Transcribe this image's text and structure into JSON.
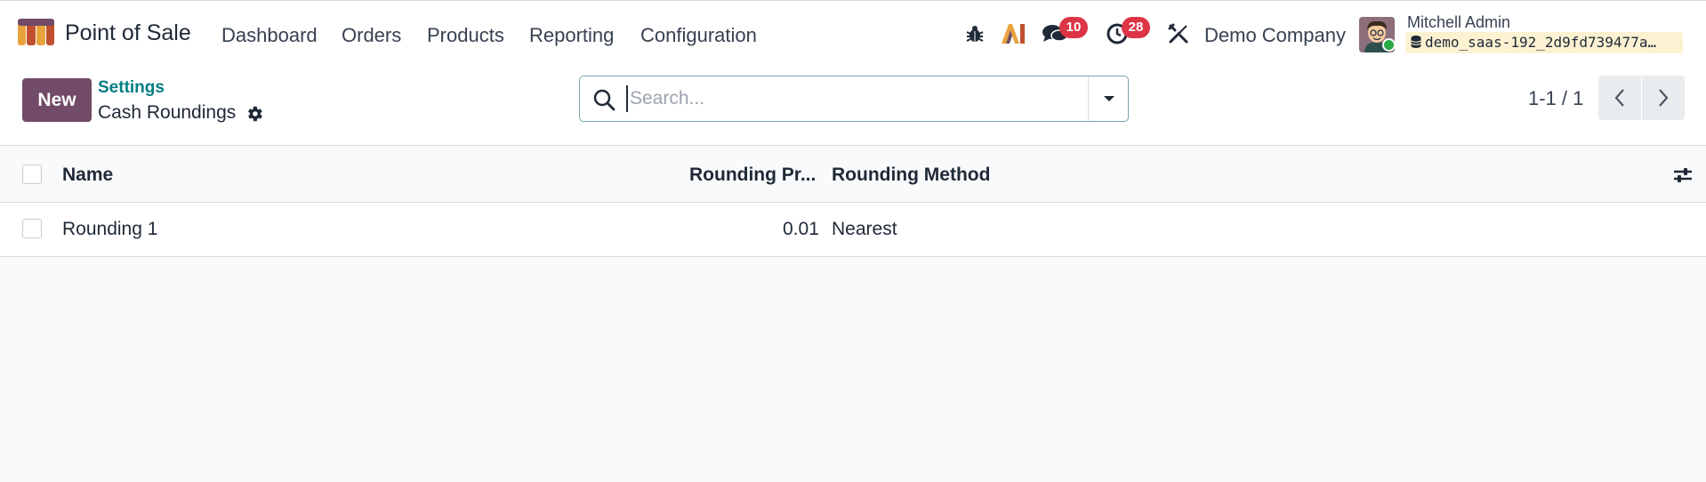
{
  "app": {
    "name": "Point of Sale",
    "menu": [
      "Dashboard",
      "Orders",
      "Products",
      "Reporting",
      "Configuration"
    ]
  },
  "systray": {
    "messages_count": "10",
    "activities_count": "28",
    "company": "Demo Company",
    "user_name": "Mitchell Admin",
    "database": "demo_saas-192_2d9fd739477a…"
  },
  "control_panel": {
    "new_label": "New",
    "breadcrumb_parent": "Settings",
    "title": "Cash Roundings",
    "search_placeholder": "Search...",
    "pager": "1-1 / 1"
  },
  "table": {
    "columns": [
      "Name",
      "Rounding Pr...",
      "Rounding Method"
    ],
    "rows": [
      {
        "name": "Rounding 1",
        "precision": "0.01",
        "method": "Nearest"
      }
    ]
  },
  "colors": {
    "primary": "#714b67",
    "link": "#017e84",
    "badge": "#dc3545"
  }
}
